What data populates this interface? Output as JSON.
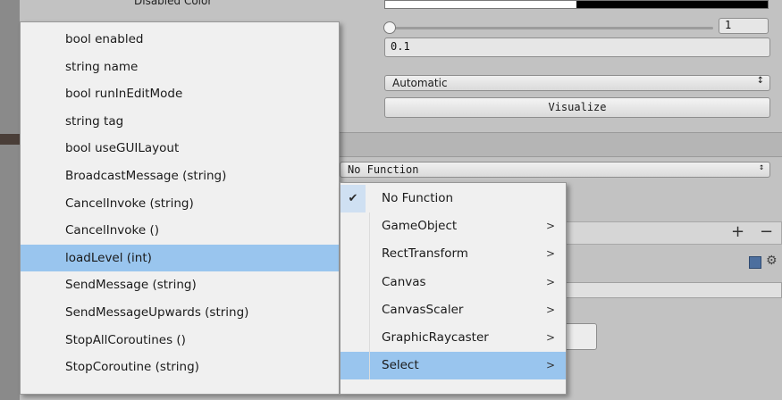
{
  "background": {
    "top_label": "Disabled Color",
    "slider_value": "1",
    "fade_field": "0.1",
    "navigation_popup": "Automatic",
    "visualize_button": "Visualize",
    "function_popup": "No Function",
    "popup_arrow": "↕",
    "plus_label": "+",
    "minus_label": "−",
    "gear_glyph": "⚙"
  },
  "left_menu": {
    "items": [
      {
        "label": "bool enabled"
      },
      {
        "label": "string name"
      },
      {
        "label": "bool runInEditMode"
      },
      {
        "label": "string tag"
      },
      {
        "label": "bool useGUILayout"
      },
      {
        "label": "BroadcastMessage (string)"
      },
      {
        "label": "CancelInvoke (string)"
      },
      {
        "label": "CancelInvoke ()"
      },
      {
        "label": "loadLevel (int)"
      },
      {
        "label": "SendMessage (string)"
      },
      {
        "label": "SendMessageUpwards (string)"
      },
      {
        "label": "StopAllCoroutines ()"
      },
      {
        "label": "StopCoroutine (string)"
      }
    ],
    "highlighted_index": 8
  },
  "right_menu": {
    "check_glyph": "✔",
    "chevron_glyph": ">",
    "items": [
      {
        "label": "No Function"
      },
      {
        "label": "GameObject"
      },
      {
        "label": "RectTransform"
      },
      {
        "label": "Canvas"
      },
      {
        "label": "CanvasScaler"
      },
      {
        "label": "GraphicRaycaster"
      },
      {
        "label": "Select"
      }
    ],
    "checked_index": 0,
    "highlighted_index": 6
  },
  "colors": {
    "highlight": "#99c5ee",
    "menu_bg": "#f0f0f0",
    "panel_bg": "#c2c2c2"
  }
}
